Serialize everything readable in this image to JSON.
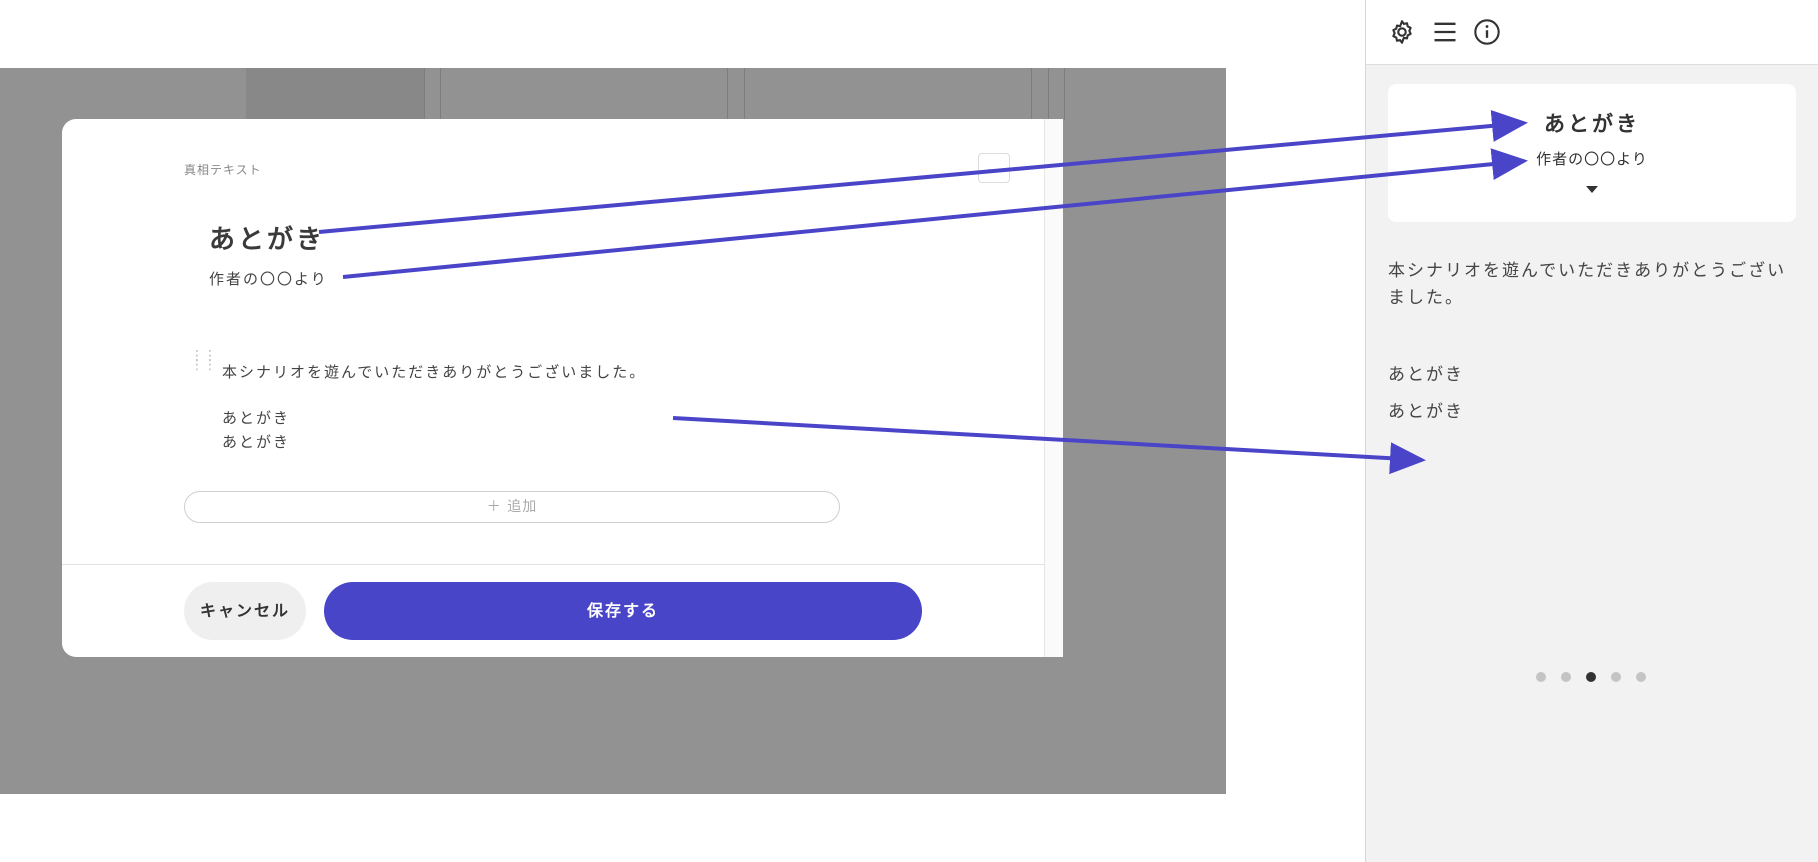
{
  "modal": {
    "label": "真相テキスト",
    "more_button": "…",
    "title": "あとがき",
    "subtitle": "作者の〇〇より",
    "body_lines": [
      "本シナリオを遊んでいただきありがとうございました。",
      "あとがき",
      "あとがき"
    ],
    "add_button": "＋ 追加",
    "cancel_button": "キャンセル",
    "save_button": "保存する"
  },
  "preview": {
    "header_icons": [
      "gear-icon",
      "menu-icon",
      "info-icon"
    ],
    "card_title": "あとがき",
    "card_subtitle": "作者の〇〇より",
    "body": "本シナリオを遊んでいただきありがとうございました。",
    "lines": [
      "あとがき",
      "あとがき"
    ],
    "pagination": {
      "total": 5,
      "current": 3
    }
  },
  "colors": {
    "accent": "#4845c8",
    "arrow": "#4a44c8",
    "backdrop": "#929292"
  }
}
